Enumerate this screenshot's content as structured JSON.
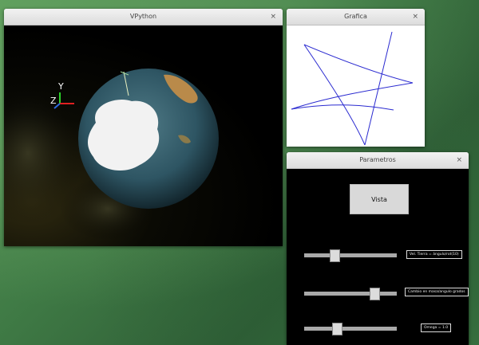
{
  "vpython": {
    "title": "VPython",
    "close": "×",
    "axis_labels": {
      "y": "Y",
      "z": "Z"
    }
  },
  "grafica": {
    "title": "Grafica",
    "close": "×",
    "plot_color": "#2a2ad0"
  },
  "parametros": {
    "title": "Parametros",
    "close": "×",
    "button_label": "Vista",
    "sliders": [
      {
        "label": "Vel. Tierra = ángulo/rot(10)",
        "value_fraction": 0.3
      },
      {
        "label": "Cambio en masa/angulo grados",
        "value_fraction": 0.78
      },
      {
        "label": "Omega = 1.0",
        "value_fraction": 0.33
      }
    ]
  }
}
